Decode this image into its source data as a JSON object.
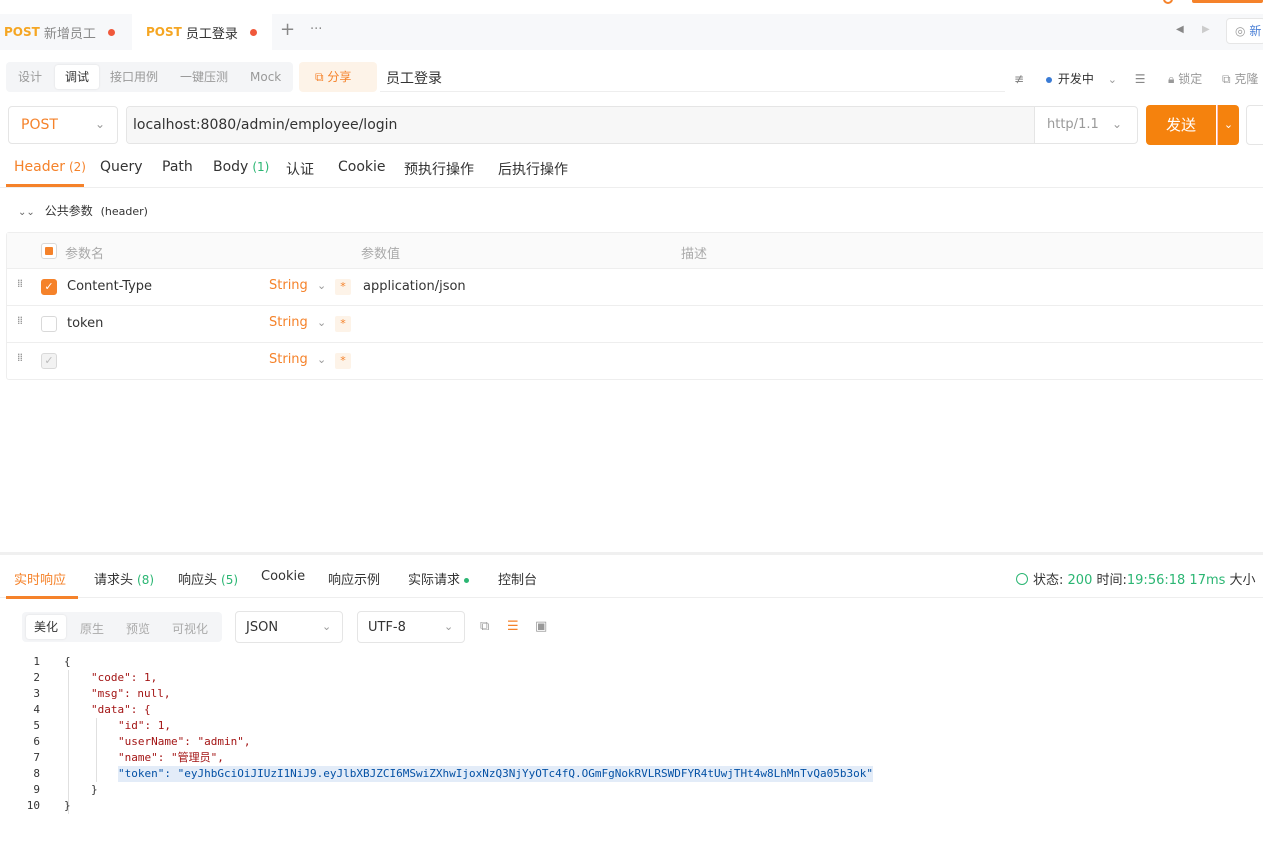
{
  "tabs": [
    {
      "method": "POST",
      "name": "新增员工"
    },
    {
      "method": "POST",
      "name": "员工登录"
    }
  ],
  "tab_bar": {
    "add": "+",
    "more": "···",
    "window_btn": "新"
  },
  "modes": [
    "设计",
    "调试",
    "接口用例",
    "一键压测",
    "Mock"
  ],
  "share_label": "分享",
  "page_title": "员工登录",
  "env": {
    "name": "开发中",
    "lock": "锁定",
    "clone": "克隆"
  },
  "request": {
    "method": "POST",
    "url": "localhost:8080/admin/employee/login",
    "http_version": "http/1.1",
    "send_label": "发送"
  },
  "req_tabs": [
    {
      "label": "Header",
      "count": "(2)"
    },
    {
      "label": "Query",
      "count": ""
    },
    {
      "label": "Path",
      "count": ""
    },
    {
      "label": "Body",
      "count": "(1)"
    },
    {
      "label": "认证",
      "count": ""
    },
    {
      "label": "Cookie",
      "count": ""
    },
    {
      "label": "预执行操作",
      "count": ""
    },
    {
      "label": "后执行操作",
      "count": ""
    }
  ],
  "public_params": {
    "label": "公共参数",
    "suffix": "(header)"
  },
  "param_table": {
    "headers": [
      "参数名",
      "参数值",
      "描述"
    ],
    "rows": [
      {
        "name": "Content-Type",
        "type": "String",
        "required": "*",
        "value": "application/json",
        "checked": true
      },
      {
        "name": "token",
        "type": "String",
        "required": "*",
        "value": "",
        "checked": false
      },
      {
        "name": "",
        "type": "String",
        "required": "*",
        "value": "",
        "checked": "dim"
      }
    ]
  },
  "resp_tabs": [
    {
      "label": "实时响应",
      "count": ""
    },
    {
      "label": "请求头",
      "count": "(8)"
    },
    {
      "label": "响应头",
      "count": "(5)"
    },
    {
      "label": "Cookie",
      "count": ""
    },
    {
      "label": "响应示例",
      "count": ""
    },
    {
      "label": "实际请求",
      "count": ""
    },
    {
      "label": "控制台",
      "count": ""
    }
  ],
  "status": {
    "status_label": "状态:",
    "status_value": "200",
    "time_label": "时间:",
    "time_value": "19:56:18",
    "duration": "17ms",
    "size_label": "大小"
  },
  "view_modes": [
    "美化",
    "原生",
    "预览",
    "可视化"
  ],
  "format": "JSON",
  "encoding": "UTF-8",
  "code_lines": [
    {
      "n": "1",
      "t": "{"
    },
    {
      "n": "2",
      "t": "\"code\": 1,"
    },
    {
      "n": "3",
      "t": "\"msg\": null,"
    },
    {
      "n": "4",
      "t": "\"data\": {"
    },
    {
      "n": "5",
      "t": "\"id\": 1,"
    },
    {
      "n": "6",
      "t": "\"userName\": \"admin\","
    },
    {
      "n": "7",
      "t": "\"name\": \"管理员\","
    },
    {
      "n": "8",
      "t": "\"token\": \"eyJhbGciOiJIUzI1NiJ9.eyJlbXBJZCI6MSwiZXhwIjoxNzQ3NjYyOTc4fQ.OGmFgNokRVLRSWDFYR4tUwjTHt4w8LhMnTvQa05b3ok\""
    },
    {
      "n": "9",
      "t": "}"
    },
    {
      "n": "10",
      "t": "}"
    }
  ],
  "colors": {
    "accent": "#f5822a",
    "send": "#f5820d",
    "success": "#2bb673",
    "env_dot": "#3a7bd5"
  }
}
